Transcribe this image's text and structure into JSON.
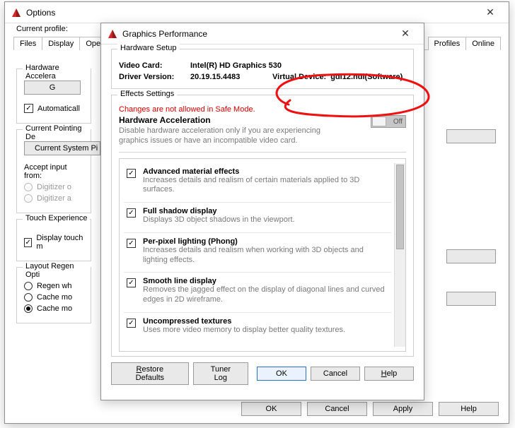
{
  "options": {
    "title": "Options",
    "profile_label": "Current profile:",
    "tabs": [
      "Files",
      "Display",
      "Ope",
      "",
      "Profiles",
      "Online"
    ],
    "groups": {
      "hwaccel": {
        "legend": "Hardware Accelera",
        "button": "G",
        "auto_check": "Automaticall"
      },
      "pointing": {
        "legend": "Current Pointing De",
        "button": "Current System Pi",
        "accept_label": "Accept input from:",
        "radio1": "Digitizer o",
        "radio2": "Digitizer a"
      },
      "touch": {
        "legend": "Touch Experience",
        "check": "Display touch m"
      },
      "layout": {
        "legend": "Layout Regen Opti",
        "radio1": "Regen wh",
        "radio2": "Cache mo",
        "radio3": "Cache mo"
      }
    },
    "buttons": {
      "ok": "OK",
      "cancel": "Cancel",
      "apply": "Apply",
      "help": "Help"
    }
  },
  "gfx": {
    "title": "Graphics Performance",
    "hardware_setup": {
      "legend": "Hardware Setup",
      "video_card_label": "Video Card:",
      "video_card_value": "Intel(R) HD Graphics 530",
      "driver_label": "Driver Version:",
      "driver_value": "20.19.15.4483",
      "virtual_label": "Virtual Device:",
      "virtual_value": "gdi12.hdi(Software)"
    },
    "effects": {
      "legend": "Effects Settings",
      "warning": "Changes are not allowed in Safe Mode.",
      "hwaccel_title": "Hardware Acceleration",
      "hwaccel_desc": "Disable hardware acceleration only if you are experiencing graphics issues or have an incompatible video card.",
      "toggle_state": "Off",
      "items": [
        {
          "title": "Advanced material effects",
          "desc": "Increases details and realism of certain materials applied to 3D surfaces.",
          "checked": true
        },
        {
          "title": "Full shadow display",
          "desc": "Displays 3D object shadows in the viewport.",
          "checked": true
        },
        {
          "title": "Per-pixel lighting (Phong)",
          "desc": "Increases details and realism when working with 3D objects and lighting effects.",
          "checked": true
        },
        {
          "title": "Smooth line display",
          "desc": "Removes the jagged effect on the display of diagonal lines and curved edges in 2D wireframe.",
          "checked": true
        },
        {
          "title": "Uncompressed textures",
          "desc": "Uses more video memory to display better quality textures.",
          "checked": true
        }
      ]
    },
    "buttons": {
      "restore": "Restore Defaults",
      "tuner": "Tuner Log",
      "ok": "OK",
      "cancel": "Cancel",
      "help": "Help"
    }
  }
}
